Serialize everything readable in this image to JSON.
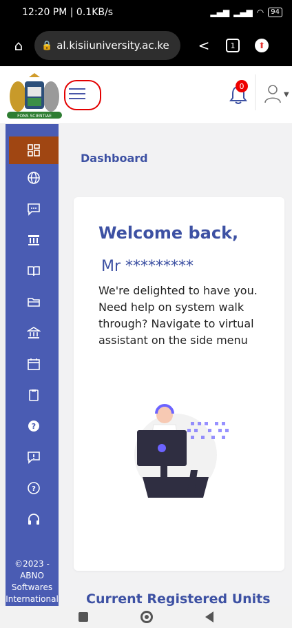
{
  "status_bar": {
    "time_speed": "12:20 PM | 0.1KB/s",
    "battery": "94"
  },
  "browser": {
    "url": "al.kisiiuniversity.ac.ke",
    "tab_count": "1"
  },
  "header": {
    "logo_motto": "FONS SCIENTIAE",
    "notification_count": "0"
  },
  "sidebar": {
    "items": [
      {
        "icon": "dashboard-grid-icon",
        "active": true
      },
      {
        "icon": "globe-icon"
      },
      {
        "icon": "chat-message-icon"
      },
      {
        "icon": "bank-icon"
      },
      {
        "icon": "open-book-icon"
      },
      {
        "icon": "folder-icon"
      },
      {
        "icon": "institution-icon"
      },
      {
        "icon": "calendar-icon"
      },
      {
        "icon": "clipboard-icon"
      },
      {
        "icon": "help-filled-icon"
      },
      {
        "icon": "report-alert-icon"
      },
      {
        "icon": "help-outline-icon"
      },
      {
        "icon": "headphones-icon"
      }
    ],
    "footer_lines": [
      "©2023 -",
      "ABNO",
      "Softwares",
      "International"
    ]
  },
  "main": {
    "dashboard_label": "Dashboard",
    "welcome_title": "Welcome back,",
    "user_name": "Mr *********",
    "welcome_message": "We're delighted to have you. Need help on system walk through? Navigate to virtual assistant on the side menu",
    "section_title": "Current Registered Units"
  },
  "colors": {
    "primary": "#3d51a3",
    "sidebar": "#4a5cb3",
    "active": "#a04612",
    "alert": "#e30000"
  }
}
